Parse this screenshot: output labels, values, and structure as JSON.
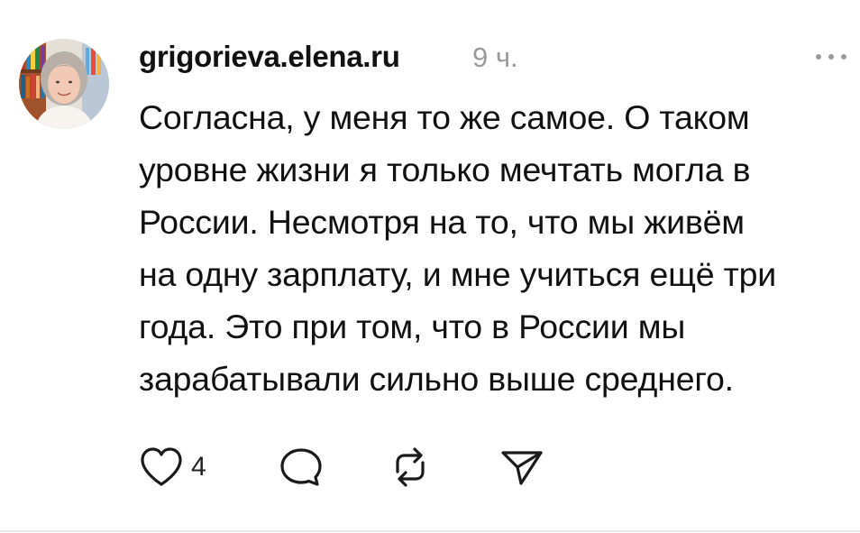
{
  "post": {
    "username": "grigorieva.elena.ru",
    "timestamp": "9 ч.",
    "more_icon": "more-horizontal-icon",
    "text_lines": [
      "Согласна, у меня то же самое. О таком",
      "уровне жизни я только мечтать могла в",
      "России. Несмотря на то, что мы живём",
      "на одну зарплату, и мне учиться ещё три",
      "года. Это при том, что в России мы",
      "зарабатывали сильно выше среднего."
    ]
  },
  "actions": {
    "like_icon": "heart-icon",
    "like_count": "4",
    "comment_icon": "comment-bubble-icon",
    "repost_icon": "repost-icon",
    "share_icon": "send-icon"
  },
  "colors": {
    "text": "#111111",
    "muted": "#9a9a9a",
    "icon": "#1a1a1a",
    "divider": "#e9e9e9"
  }
}
